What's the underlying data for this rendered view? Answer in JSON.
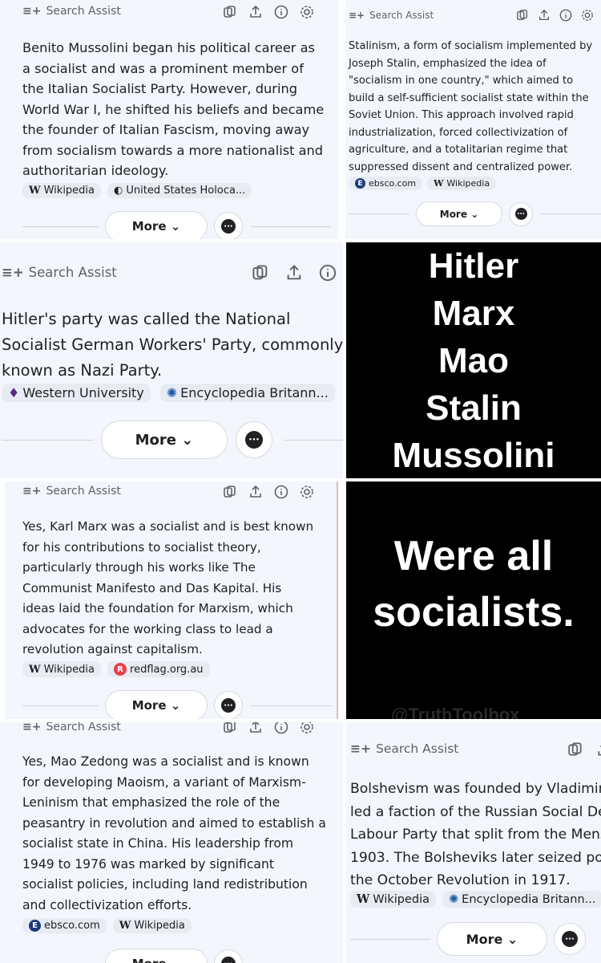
{
  "common": {
    "header_label": "Search Assist",
    "more_label": "More",
    "chevron": "⌄",
    "spark_glyph": "≡+",
    "chat_glyph": "•••"
  },
  "p1": {
    "text": "Benito Mussolini began his political career as a socialist and was a prominent member of the Italian Socialist Party. However, during World War I, he shifted his beliefs and became the founder of Italian Fascism, moving away from socialism towards a more nationalist and authoritarian ideology.",
    "chips": [
      {
        "icon": "W",
        "label": "Wikipedia"
      },
      {
        "icon": "◐",
        "label": "United States Holoca..."
      }
    ]
  },
  "p2": {
    "text": "Stalinism, a form of socialism implemented by Joseph Stalin, emphasized the idea of \"socialism in one country,\" which aimed to build a self-sufficient socialist state within the Soviet Union. This approach involved rapid industrialization, forced collectivization of agriculture, and a totalitarian regime that suppressed dissent and centralized power.",
    "chips": [
      {
        "icon": "E",
        "label": "ebsco.com"
      },
      {
        "icon": "W",
        "label": "Wikipedia"
      }
    ]
  },
  "p3": {
    "text": "Hitler's party was called the National Socialist German Workers' Party, commonly known as Nazi Party.",
    "chips": [
      {
        "icon": "♦",
        "label": "Western University"
      },
      {
        "icon": "✺",
        "label": "Encyclopedia Britann..."
      }
    ]
  },
  "names": {
    "lines": [
      "Hitler",
      "Marx",
      "Mao",
      "Stalin",
      "Mussolini"
    ]
  },
  "p4": {
    "text": "Yes, Karl Marx was a socialist and is best known for his contributions to socialist theory, particularly through his works like The Communist Manifesto and Das Kapital. His ideas laid the foundation for Marxism, which advocates for the working class to lead a revolution against capitalism.",
    "chips": [
      {
        "icon": "W",
        "label": "Wikipedia"
      },
      {
        "icon": "R",
        "label": "redflag.org.au"
      }
    ]
  },
  "socialists": {
    "lines": [
      "Were all",
      "socialists."
    ],
    "watermark": "@TruthToolbox"
  },
  "p5": {
    "text": "Yes, Mao Zedong was a socialist and is known for developing Maoism, a variant of Marxism-Leninism that emphasized the role of the peasantry in revolution and aimed to establish a socialist state in China. His leadership from 1949 to 1976 was marked by significant socialist policies, including land redistribution and collectivization efforts.",
    "chips": [
      {
        "icon": "E",
        "label": "ebsco.com"
      },
      {
        "icon": "W",
        "label": "Wikipedia"
      }
    ]
  },
  "p6": {
    "text": "Bolshevism was founded by Vladimir Lenin who led a faction of the Russian Social Democratic Labour Party that split from the Mensheviks in 1903. The Bolsheviks later seized power during the October Revolution in 1917.",
    "chips": [
      {
        "icon": "W",
        "label": "Wikipedia"
      },
      {
        "icon": "✺",
        "label": "Encyclopedia Britann..."
      }
    ]
  },
  "colors": {
    "panel_bg": "#f3f6fd",
    "chip_bg": "#e7ebf3",
    "ebsco": "#1b3a7a",
    "redflag": "#e8424b",
    "western": "#5a2a82",
    "britannica": "#1e5aa8"
  }
}
